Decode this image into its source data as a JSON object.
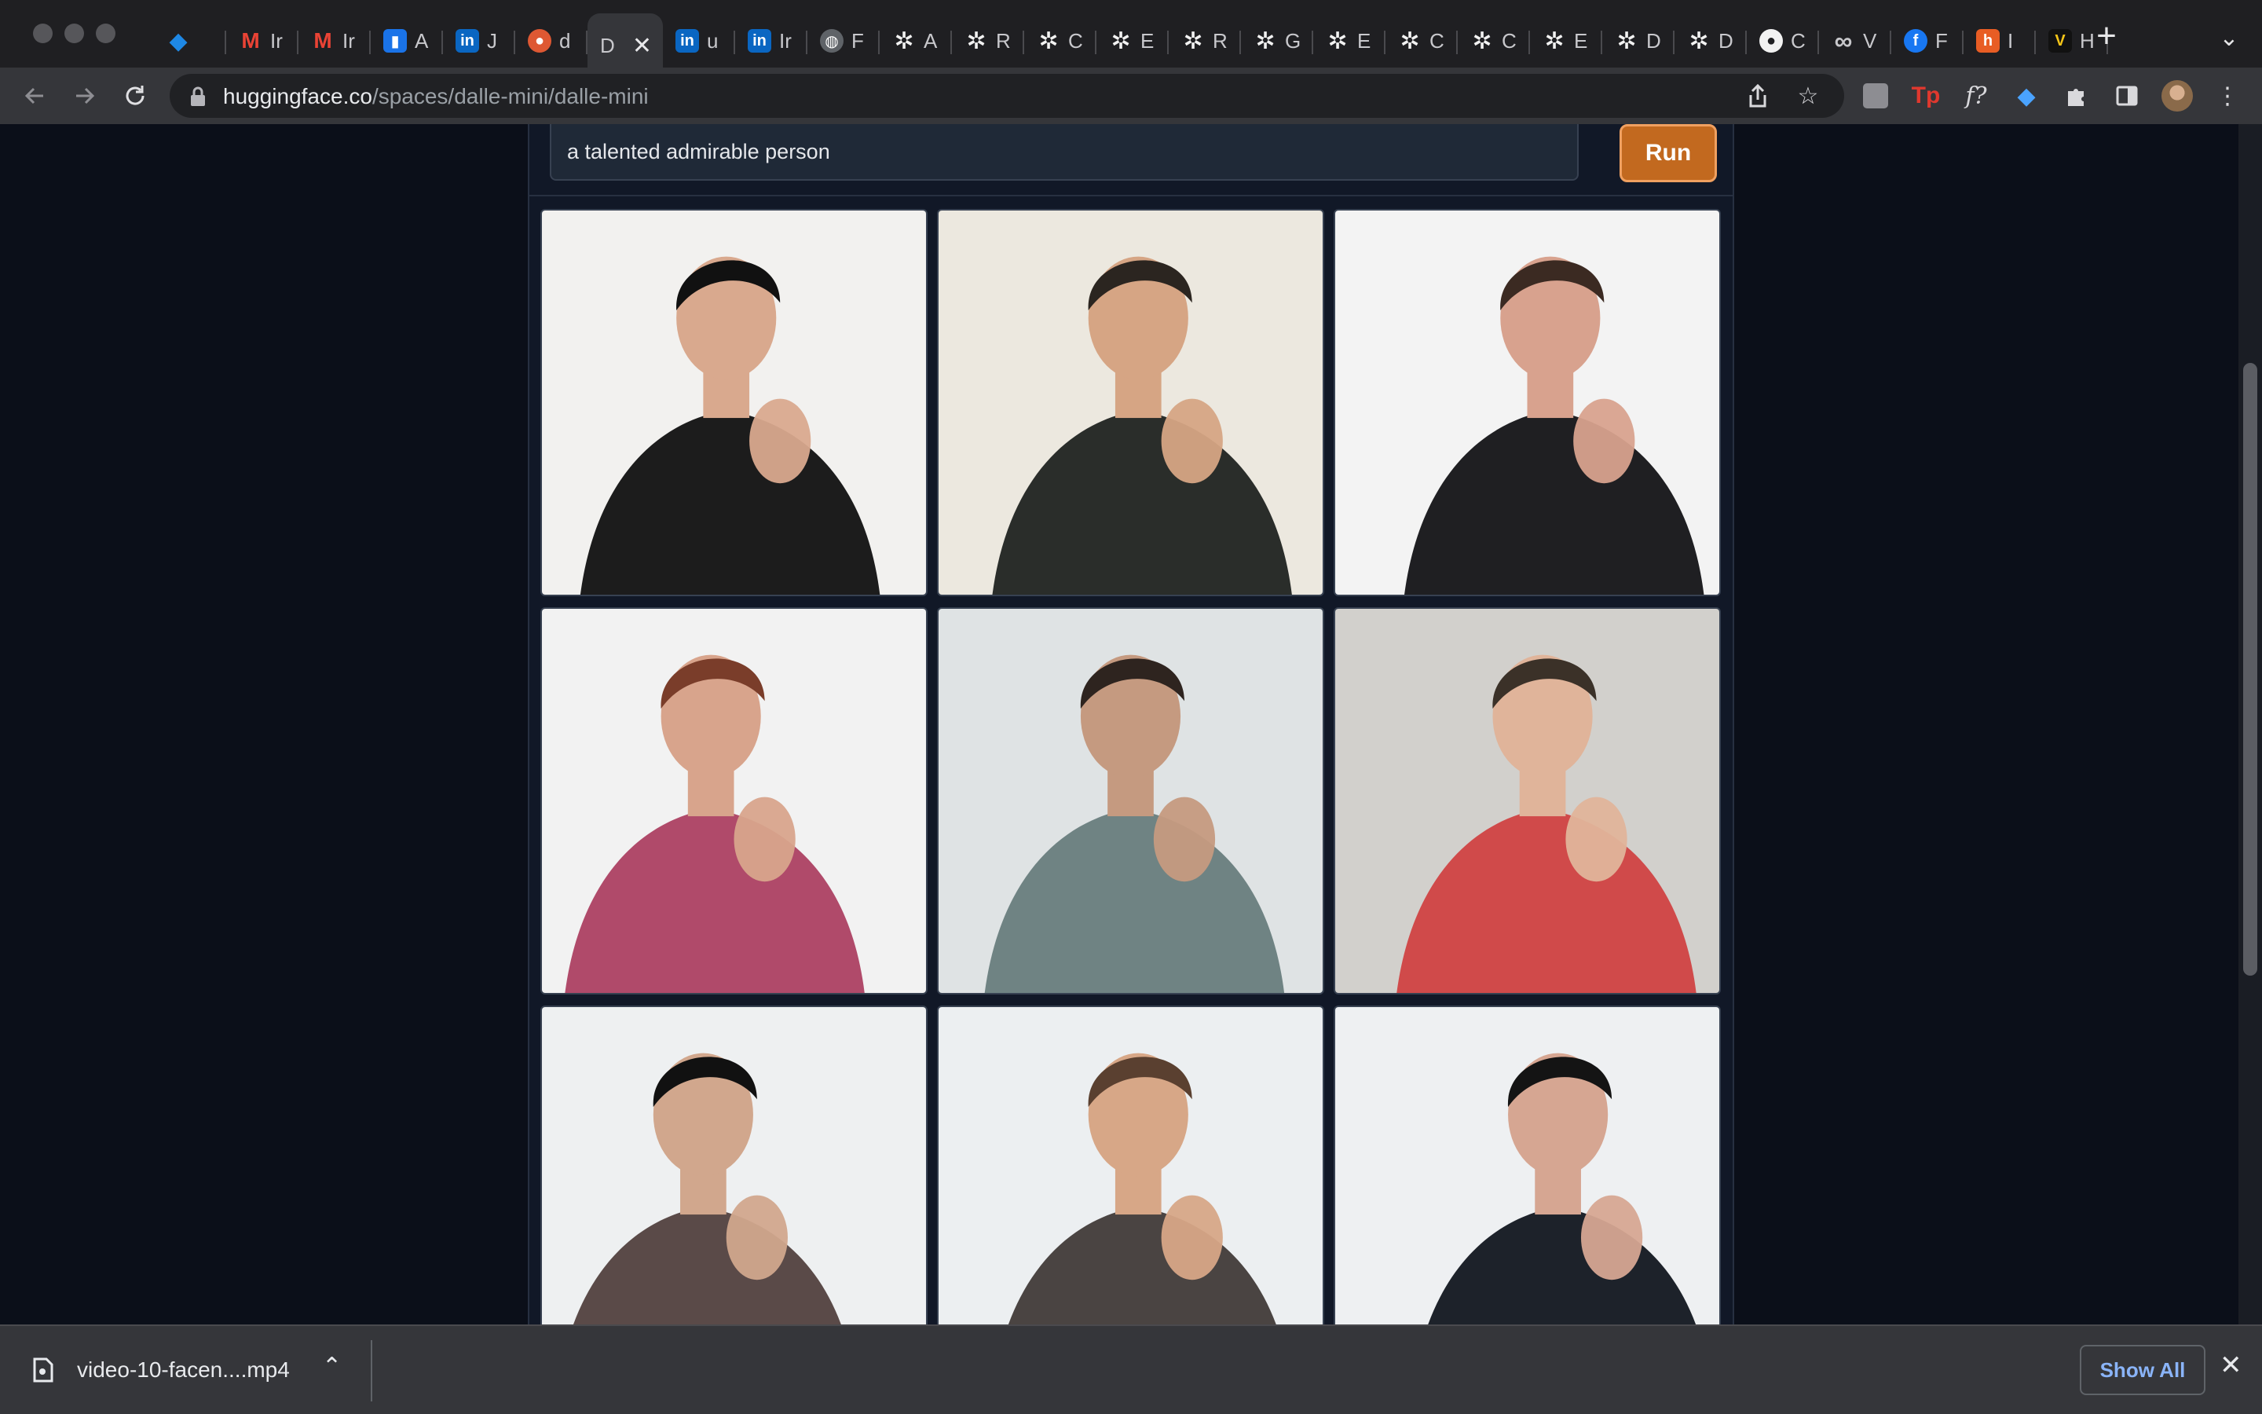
{
  "browser": {
    "tabs": [
      {
        "icon": "gem-icon",
        "label": "",
        "color": "#1e88e5"
      },
      {
        "icon": "gmail-icon",
        "label": "Ir",
        "color": "#ea4335"
      },
      {
        "icon": "gmail-icon",
        "label": "Ir",
        "color": "#ea4335"
      },
      {
        "icon": "analytics-icon",
        "label": "A",
        "color": "#1a73e8"
      },
      {
        "icon": "linkedin-icon",
        "label": "J",
        "color": "#0a66c2"
      },
      {
        "icon": "duckduckgo-icon",
        "label": "d",
        "color": "#de5833"
      },
      {
        "icon": "huggingface-icon",
        "label": "D",
        "color": "#35363a",
        "active": true
      },
      {
        "icon": "linkedin-icon",
        "label": "u",
        "color": "#0a66c2"
      },
      {
        "icon": "linkedin-icon",
        "label": "Ir",
        "color": "#0a66c2"
      },
      {
        "icon": "globe-icon",
        "label": "F",
        "color": "#5f6368"
      },
      {
        "icon": "openai-icon",
        "label": "A",
        "color": "#1f1f22"
      },
      {
        "icon": "openai-icon",
        "label": "R",
        "color": "#1f1f22"
      },
      {
        "icon": "openai-icon",
        "label": "C",
        "color": "#1f1f22"
      },
      {
        "icon": "openai-icon",
        "label": "E",
        "color": "#1f1f22"
      },
      {
        "icon": "openai-icon",
        "label": "R",
        "color": "#1f1f22"
      },
      {
        "icon": "openai-icon",
        "label": "G",
        "color": "#1f1f22"
      },
      {
        "icon": "openai-icon",
        "label": "E",
        "color": "#1f1f22"
      },
      {
        "icon": "openai-icon",
        "label": "C",
        "color": "#1f1f22"
      },
      {
        "icon": "openai-icon",
        "label": "C",
        "color": "#1f1f22"
      },
      {
        "icon": "openai-icon",
        "label": "E",
        "color": "#1f1f22"
      },
      {
        "icon": "openai-icon",
        "label": "D",
        "color": "#1f1f22"
      },
      {
        "icon": "openai-icon",
        "label": "D",
        "color": "#1f1f22"
      },
      {
        "icon": "github-icon",
        "label": "C",
        "color": "#1f1f22"
      },
      {
        "icon": "infinity-icon",
        "label": "V",
        "color": "#1f1f22"
      },
      {
        "icon": "facebook-icon",
        "label": "F",
        "color": "#1877f2"
      },
      {
        "icon": "hvg-icon",
        "label": "I",
        "color": "#e85d24"
      },
      {
        "icon": "v-icon",
        "label": "H",
        "color": "#f5c518"
      }
    ],
    "active_tab_label": "D",
    "url_host": "huggingface.co",
    "url_path": "/spaces/dalle-mini/dalle-mini"
  },
  "app": {
    "prompt_value": "a talented admirable person",
    "run_label": "Run",
    "accent": "#c2691f",
    "images": [
      {
        "name": "result-image-1",
        "bg": "#f2f1ef",
        "skin": "#d9a98e",
        "cloth": "#1c1c1c",
        "hair": "#111111"
      },
      {
        "name": "result-image-2",
        "bg": "#ece8df",
        "skin": "#d6a584",
        "cloth": "#2a2d2a",
        "hair": "#2b2520"
      },
      {
        "name": "result-image-3",
        "bg": "#f3f3f3",
        "skin": "#d8a28e",
        "cloth": "#1f1f22",
        "hair": "#3b2a22"
      },
      {
        "name": "result-image-4",
        "bg": "#f2f2f2",
        "skin": "#d8a48c",
        "cloth": "#b04a6a",
        "hair": "#7a3d2a"
      },
      {
        "name": "result-image-5",
        "bg": "#dfe3e4",
        "skin": "#c59a80",
        "cloth": "#6f8383",
        "hair": "#2e241f"
      },
      {
        "name": "result-image-6",
        "bg": "#d2d0cc",
        "skin": "#e0b49a",
        "cloth": "#d04a4a",
        "hair": "#3b3128"
      },
      {
        "name": "result-image-7",
        "bg": "#eef0f1",
        "skin": "#d1a78d",
        "cloth": "#5a4a48",
        "hair": "#111111"
      },
      {
        "name": "result-image-8",
        "bg": "#eceff1",
        "skin": "#d7a787",
        "cloth": "#4a4442",
        "hair": "#5a4030"
      },
      {
        "name": "result-image-9",
        "bg": "#eef0f2",
        "skin": "#d6a692",
        "cloth": "#1d222a",
        "hair": "#141414"
      }
    ]
  },
  "downloads": {
    "file_name": "video-10-facen....mp4",
    "show_all_label": "Show All"
  }
}
